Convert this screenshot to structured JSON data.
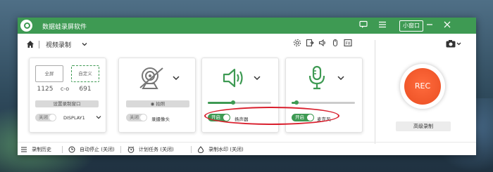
{
  "app": {
    "title": "数据蛙录屏软件"
  },
  "titlebar": {
    "mini_window_label": "小窗口"
  },
  "toolbar": {
    "mode_label": "视频录制"
  },
  "screen_card": {
    "fullscreen_label": "全屏",
    "custom_label": "自定义",
    "width": "1125",
    "height": "691",
    "lock_symbol": "c-o",
    "set_window_label": "设置录制窗口",
    "toggle_label": "关闭",
    "display_label": "DISPLAY1"
  },
  "camera_card": {
    "photo_label": "拍照",
    "toggle_label": "关闭",
    "name": "录摄像头"
  },
  "speaker_card": {
    "toggle_label": "开启",
    "name": "扬声器",
    "volume": 0.4
  },
  "mic_card": {
    "toggle_label": "开启",
    "name": "麦克风",
    "volume": 0.08
  },
  "rec": {
    "button_label": "REC",
    "advanced_label": "高级录制"
  },
  "footer": {
    "history": "录制历史",
    "auto_stop": "自动停止 (关闭)",
    "schedule": "计划任务 (关闭)",
    "watermark": "录制水印 (关闭)"
  },
  "colors": {
    "brand_green": "#3e9a53",
    "rec_orange": "#ea4e22",
    "highlight_red": "#d9202e"
  }
}
